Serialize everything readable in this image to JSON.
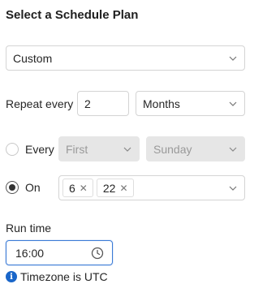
{
  "title": "Select a Schedule Plan",
  "plan_select": {
    "value": "Custom"
  },
  "repeat": {
    "label": "Repeat every",
    "count": "2",
    "unit": "Months"
  },
  "every_option": {
    "label": "Every",
    "selected": false,
    "ordinal": "First",
    "weekday": "Sunday"
  },
  "on_option": {
    "label": "On",
    "selected": true,
    "days": [
      "6",
      "22"
    ]
  },
  "run_time": {
    "label": "Run time",
    "value": "16:00"
  },
  "timezone_note": "Timezone is UTC",
  "icons": {
    "dropdown": "chevron-down-icon",
    "tag_remove": "close-icon",
    "time": "clock-icon",
    "info": "info-icon"
  },
  "colors": {
    "focus_border": "#3b7bd6",
    "info": "#1a66c9",
    "disabled_bg": "#e6e6e6"
  }
}
